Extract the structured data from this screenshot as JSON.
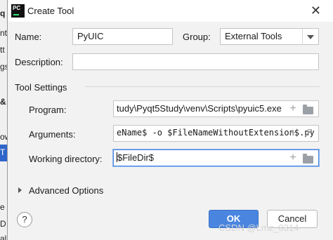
{
  "window": {
    "title": "Create Tool",
    "icon_text": "PC"
  },
  "form": {
    "name_label": "Name:",
    "name_value": "PyUIC",
    "group_label": "Group:",
    "group_value": "External Tools",
    "description_label": "Description:",
    "description_value": ""
  },
  "tool_settings": {
    "section_title": "Tool Settings",
    "program_label": "Program:",
    "program_value": "tudy\\Pyqt5Study\\venv\\Scripts\\pyuic5.exe",
    "arguments_label": "Arguments:",
    "arguments_value": "eName$ -o $FileNameWithoutExtension$.py",
    "working_dir_label": "Working directory:",
    "working_dir_value": "$FileDir$"
  },
  "advanced": {
    "label": "Advanced Options"
  },
  "buttons": {
    "ok": "OK",
    "cancel": "Cancel",
    "help": "?"
  },
  "watermark": "CSDN @Lmz_0314",
  "background_ide": [
    "q",
    "nt",
    "tt",
    "gs",
    "&",
    "ow",
    "T",
    "e",
    "D",
    "al Tools"
  ]
}
